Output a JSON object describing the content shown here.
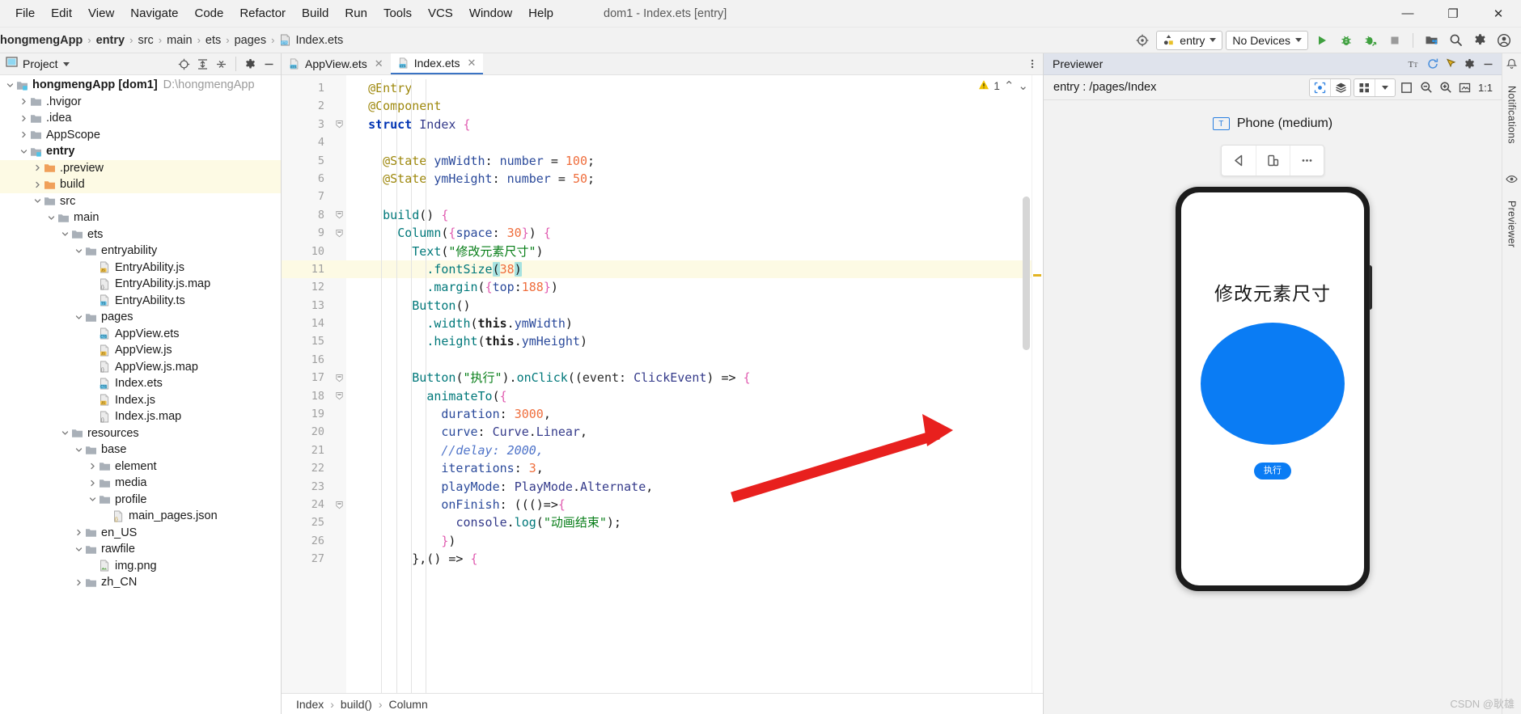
{
  "window": {
    "title": "dom1 - Index.ets [entry]",
    "menu": [
      "File",
      "Edit",
      "View",
      "Navigate",
      "Code",
      "Refactor",
      "Build",
      "Run",
      "Tools",
      "VCS",
      "Window",
      "Help"
    ],
    "controls": {
      "minimize": "—",
      "maximize": "❐",
      "close": "✕"
    }
  },
  "navbar": {
    "breadcrumbs": [
      "hongmengApp",
      "entry",
      "src",
      "main",
      "ets",
      "pages",
      "Index.ets"
    ],
    "run_config": "entry",
    "device_selector": "No Devices",
    "icons": [
      "target-icon",
      "run-icon",
      "debug-icon",
      "profile-icon",
      "stop-icon",
      "device-manager-icon",
      "search-icon",
      "settings-gear-icon",
      "account-icon"
    ]
  },
  "project_panel": {
    "title": "Project",
    "tools": [
      "locate-icon",
      "expand-all-icon",
      "collapse-all-icon",
      "settings-gear-icon",
      "hide-icon"
    ],
    "tree": [
      {
        "label": "hongmengApp [dom1]",
        "suffix": "D:\\hongmengApp",
        "depth": 0,
        "arrow": "down",
        "icon": "module-folder",
        "bold": true
      },
      {
        "label": ".hvigor",
        "depth": 1,
        "arrow": "right",
        "icon": "folder"
      },
      {
        "label": ".idea",
        "depth": 1,
        "arrow": "right",
        "icon": "folder"
      },
      {
        "label": "AppScope",
        "depth": 1,
        "arrow": "right",
        "icon": "folder"
      },
      {
        "label": "entry",
        "depth": 1,
        "arrow": "down",
        "icon": "module-folder",
        "bold": true
      },
      {
        "label": ".preview",
        "depth": 2,
        "arrow": "right",
        "icon": "folder-orange",
        "highlight": true
      },
      {
        "label": "build",
        "depth": 2,
        "arrow": "right",
        "icon": "folder-orange",
        "highlight": true
      },
      {
        "label": "src",
        "depth": 2,
        "arrow": "down",
        "icon": "folder"
      },
      {
        "label": "main",
        "depth": 3,
        "arrow": "down",
        "icon": "folder"
      },
      {
        "label": "ets",
        "depth": 4,
        "arrow": "down",
        "icon": "folder"
      },
      {
        "label": "entryability",
        "depth": 5,
        "arrow": "down",
        "icon": "folder"
      },
      {
        "label": "EntryAbility.js",
        "depth": 6,
        "arrow": "none",
        "icon": "js-file"
      },
      {
        "label": "EntryAbility.js.map",
        "depth": 6,
        "arrow": "none",
        "icon": "map-file"
      },
      {
        "label": "EntryAbility.ts",
        "depth": 6,
        "arrow": "none",
        "icon": "ts-file"
      },
      {
        "label": "pages",
        "depth": 5,
        "arrow": "down",
        "icon": "folder"
      },
      {
        "label": "AppView.ets",
        "depth": 6,
        "arrow": "none",
        "icon": "ets-file"
      },
      {
        "label": "AppView.js",
        "depth": 6,
        "arrow": "none",
        "icon": "js-file"
      },
      {
        "label": "AppView.js.map",
        "depth": 6,
        "arrow": "none",
        "icon": "map-file"
      },
      {
        "label": "Index.ets",
        "depth": 6,
        "arrow": "none",
        "icon": "ets-file"
      },
      {
        "label": "Index.js",
        "depth": 6,
        "arrow": "none",
        "icon": "js-file"
      },
      {
        "label": "Index.js.map",
        "depth": 6,
        "arrow": "none",
        "icon": "map-file"
      },
      {
        "label": "resources",
        "depth": 4,
        "arrow": "down",
        "icon": "folder"
      },
      {
        "label": "base",
        "depth": 5,
        "arrow": "down",
        "icon": "folder"
      },
      {
        "label": "element",
        "depth": 6,
        "arrow": "right",
        "icon": "folder"
      },
      {
        "label": "media",
        "depth": 6,
        "arrow": "right",
        "icon": "folder"
      },
      {
        "label": "profile",
        "depth": 6,
        "arrow": "down",
        "icon": "folder"
      },
      {
        "label": "main_pages.json",
        "depth": 7,
        "arrow": "none",
        "icon": "json-file"
      },
      {
        "label": "en_US",
        "depth": 5,
        "arrow": "right",
        "icon": "folder"
      },
      {
        "label": "rawfile",
        "depth": 5,
        "arrow": "down",
        "icon": "folder"
      },
      {
        "label": "img.png",
        "depth": 6,
        "arrow": "none",
        "icon": "png-file"
      },
      {
        "label": "zh_CN",
        "depth": 5,
        "arrow": "right",
        "icon": "folder"
      }
    ]
  },
  "editor": {
    "tabs": [
      {
        "label": "AppView.ets",
        "icon": "ets-file",
        "active": false,
        "close": "✕"
      },
      {
        "label": "Index.ets",
        "icon": "ets-file",
        "active": true,
        "close": "✕"
      }
    ],
    "inspection": {
      "warning_count": "1",
      "up": "⌃",
      "down": "⌄"
    },
    "highlighted_line": 11,
    "breadcrumb": [
      "Index",
      "build()",
      "Column"
    ],
    "lines": [
      {
        "n": 1,
        "fold": "",
        "tokens": [
          {
            "t": "  ",
            "c": "t-pl"
          },
          {
            "t": "@Entry",
            "c": "t-ann"
          }
        ]
      },
      {
        "n": 2,
        "fold": "",
        "tokens": [
          {
            "t": "  ",
            "c": "t-pl"
          },
          {
            "t": "@Component",
            "c": "t-ann"
          }
        ]
      },
      {
        "n": 3,
        "fold": "minus",
        "tokens": [
          {
            "t": "  ",
            "c": "t-pl"
          },
          {
            "t": "struct",
            "c": "t-kw"
          },
          {
            "t": " ",
            "c": "t-pl"
          },
          {
            "t": "Index",
            "c": "t-cls"
          },
          {
            "t": " ",
            "c": "t-pl"
          },
          {
            "t": "{",
            "c": "t-brace"
          }
        ]
      },
      {
        "n": 4,
        "fold": "",
        "tokens": []
      },
      {
        "n": 5,
        "fold": "",
        "tokens": [
          {
            "t": "    ",
            "c": "t-pl"
          },
          {
            "t": "@State",
            "c": "t-ann"
          },
          {
            "t": " ",
            "c": "t-pl"
          },
          {
            "t": "ymWidth",
            "c": "t-prop"
          },
          {
            "t": ": ",
            "c": "t-pl"
          },
          {
            "t": "number",
            "c": "t-prop"
          },
          {
            "t": " = ",
            "c": "t-pl"
          },
          {
            "t": "100",
            "c": "t-num"
          },
          {
            "t": ";",
            "c": "t-pl"
          }
        ]
      },
      {
        "n": 6,
        "fold": "",
        "tokens": [
          {
            "t": "    ",
            "c": "t-pl"
          },
          {
            "t": "@State",
            "c": "t-ann"
          },
          {
            "t": " ",
            "c": "t-pl"
          },
          {
            "t": "ymHeight",
            "c": "t-prop"
          },
          {
            "t": ": ",
            "c": "t-pl"
          },
          {
            "t": "number",
            "c": "t-prop"
          },
          {
            "t": " = ",
            "c": "t-pl"
          },
          {
            "t": "50",
            "c": "t-num"
          },
          {
            "t": ";",
            "c": "t-pl"
          }
        ]
      },
      {
        "n": 7,
        "fold": "",
        "tokens": []
      },
      {
        "n": 8,
        "fold": "minus",
        "tokens": [
          {
            "t": "    ",
            "c": "t-pl"
          },
          {
            "t": "build",
            "c": "t-fn"
          },
          {
            "t": "() ",
            "c": "t-pl"
          },
          {
            "t": "{",
            "c": "t-brace"
          }
        ]
      },
      {
        "n": 9,
        "fold": "minus",
        "tokens": [
          {
            "t": "      ",
            "c": "t-pl"
          },
          {
            "t": "Column",
            "c": "t-fn"
          },
          {
            "t": "(",
            "c": "t-pl"
          },
          {
            "t": "{",
            "c": "t-brace"
          },
          {
            "t": "space",
            "c": "t-prop"
          },
          {
            "t": ": ",
            "c": "t-pl"
          },
          {
            "t": "30",
            "c": "t-num"
          },
          {
            "t": "}",
            "c": "t-brace"
          },
          {
            "t": ") ",
            "c": "t-pl"
          },
          {
            "t": "{",
            "c": "t-brace"
          }
        ]
      },
      {
        "n": 10,
        "fold": "",
        "tokens": [
          {
            "t": "        ",
            "c": "t-pl"
          },
          {
            "t": "Text",
            "c": "t-fn"
          },
          {
            "t": "(",
            "c": "t-pl"
          },
          {
            "t": "\"修改元素尺寸\"",
            "c": "t-str"
          },
          {
            "t": ")",
            "c": "t-pl"
          }
        ]
      },
      {
        "n": 11,
        "fold": "",
        "tokens": [
          {
            "t": "          ",
            "c": "t-pl"
          },
          {
            "t": ".fontSize",
            "c": "t-fn"
          },
          {
            "t": "(",
            "c": "t-pl",
            "sel": true
          },
          {
            "t": "38",
            "c": "t-num"
          },
          {
            "t": ")",
            "c": "t-pl",
            "sel": true
          }
        ]
      },
      {
        "n": 12,
        "fold": "",
        "tokens": [
          {
            "t": "          ",
            "c": "t-pl"
          },
          {
            "t": ".margin",
            "c": "t-fn"
          },
          {
            "t": "(",
            "c": "t-pl"
          },
          {
            "t": "{",
            "c": "t-brace"
          },
          {
            "t": "top",
            "c": "t-prop"
          },
          {
            "t": ":",
            "c": "t-pl"
          },
          {
            "t": "188",
            "c": "t-num"
          },
          {
            "t": "}",
            "c": "t-brace"
          },
          {
            "t": ")",
            "c": "t-pl"
          }
        ]
      },
      {
        "n": 13,
        "fold": "",
        "tokens": [
          {
            "t": "        ",
            "c": "t-pl"
          },
          {
            "t": "Button",
            "c": "t-fn"
          },
          {
            "t": "()",
            "c": "t-pl"
          }
        ]
      },
      {
        "n": 14,
        "fold": "",
        "tokens": [
          {
            "t": "          ",
            "c": "t-pl"
          },
          {
            "t": ".width",
            "c": "t-fn"
          },
          {
            "t": "(",
            "c": "t-pl"
          },
          {
            "t": "this",
            "c": "t-this"
          },
          {
            "t": ".",
            "c": "t-pl"
          },
          {
            "t": "ymWidth",
            "c": "t-prop"
          },
          {
            "t": ")",
            "c": "t-pl"
          }
        ]
      },
      {
        "n": 15,
        "fold": "",
        "tokens": [
          {
            "t": "          ",
            "c": "t-pl"
          },
          {
            "t": ".height",
            "c": "t-fn"
          },
          {
            "t": "(",
            "c": "t-pl"
          },
          {
            "t": "this",
            "c": "t-this"
          },
          {
            "t": ".",
            "c": "t-pl"
          },
          {
            "t": "ymHeight",
            "c": "t-prop"
          },
          {
            "t": ")",
            "c": "t-pl"
          }
        ]
      },
      {
        "n": 16,
        "fold": "",
        "tokens": []
      },
      {
        "n": 17,
        "fold": "minus",
        "tokens": [
          {
            "t": "        ",
            "c": "t-pl"
          },
          {
            "t": "Button",
            "c": "t-fn"
          },
          {
            "t": "(",
            "c": "t-pl"
          },
          {
            "t": "\"执行\"",
            "c": "t-str"
          },
          {
            "t": ").",
            "c": "t-pl"
          },
          {
            "t": "onClick",
            "c": "t-fn"
          },
          {
            "t": "((",
            "c": "t-pl"
          },
          {
            "t": "event",
            "c": "t-param"
          },
          {
            "t": ": ",
            "c": "t-pl"
          },
          {
            "t": "ClickEvent",
            "c": "t-cls"
          },
          {
            "t": ") => ",
            "c": "t-pl"
          },
          {
            "t": "{",
            "c": "t-brace"
          }
        ]
      },
      {
        "n": 18,
        "fold": "minus",
        "tokens": [
          {
            "t": "          ",
            "c": "t-pl"
          },
          {
            "t": "animateTo",
            "c": "t-fn"
          },
          {
            "t": "(",
            "c": "t-pl"
          },
          {
            "t": "{",
            "c": "t-brace"
          }
        ]
      },
      {
        "n": 19,
        "fold": "",
        "tokens": [
          {
            "t": "            ",
            "c": "t-pl"
          },
          {
            "t": "duration",
            "c": "t-prop"
          },
          {
            "t": ": ",
            "c": "t-pl"
          },
          {
            "t": "3000",
            "c": "t-num"
          },
          {
            "t": ",",
            "c": "t-pl"
          }
        ]
      },
      {
        "n": 20,
        "fold": "",
        "tokens": [
          {
            "t": "            ",
            "c": "t-pl"
          },
          {
            "t": "curve",
            "c": "t-prop"
          },
          {
            "t": ": ",
            "c": "t-pl"
          },
          {
            "t": "Curve",
            "c": "t-cls"
          },
          {
            "t": ".",
            "c": "t-pl"
          },
          {
            "t": "Linear",
            "c": "t-cls"
          },
          {
            "t": ",",
            "c": "t-pl"
          }
        ]
      },
      {
        "n": 21,
        "fold": "",
        "tokens": [
          {
            "t": "            ",
            "c": "t-pl"
          },
          {
            "t": "//delay: 2000,",
            "c": "t-com"
          }
        ]
      },
      {
        "n": 22,
        "fold": "",
        "tokens": [
          {
            "t": "            ",
            "c": "t-pl"
          },
          {
            "t": "iterations",
            "c": "t-prop"
          },
          {
            "t": ": ",
            "c": "t-pl"
          },
          {
            "t": "3",
            "c": "t-num"
          },
          {
            "t": ",",
            "c": "t-pl"
          }
        ]
      },
      {
        "n": 23,
        "fold": "",
        "tokens": [
          {
            "t": "            ",
            "c": "t-pl"
          },
          {
            "t": "playMode",
            "c": "t-prop"
          },
          {
            "t": ": ",
            "c": "t-pl"
          },
          {
            "t": "PlayMode",
            "c": "t-cls"
          },
          {
            "t": ".",
            "c": "t-pl"
          },
          {
            "t": "Alternate",
            "c": "t-cls"
          },
          {
            "t": ",",
            "c": "t-pl"
          }
        ]
      },
      {
        "n": 24,
        "fold": "minus",
        "tokens": [
          {
            "t": "            ",
            "c": "t-pl"
          },
          {
            "t": "onFinish",
            "c": "t-prop"
          },
          {
            "t": ": ((()=>",
            "c": "t-pl"
          },
          {
            "t": "{",
            "c": "t-brace"
          }
        ]
      },
      {
        "n": 25,
        "fold": "",
        "tokens": [
          {
            "t": "              ",
            "c": "t-pl"
          },
          {
            "t": "console",
            "c": "t-cls"
          },
          {
            "t": ".",
            "c": "t-pl"
          },
          {
            "t": "log",
            "c": "t-fn"
          },
          {
            "t": "(",
            "c": "t-pl"
          },
          {
            "t": "\"动画结束\"",
            "c": "t-str"
          },
          {
            "t": ");",
            "c": "t-pl"
          }
        ]
      },
      {
        "n": 26,
        "fold": "",
        "tokens": [
          {
            "t": "            ",
            "c": "t-pl"
          },
          {
            "t": "}",
            "c": "t-brace"
          },
          {
            "t": ")",
            "c": "t-pl"
          }
        ]
      },
      {
        "n": 27,
        "fold": "",
        "tokens": [
          {
            "t": "        ",
            "c": "t-pl"
          },
          {
            "t": "},() => ",
            "c": "t-pl"
          },
          {
            "t": "{",
            "c": "t-brace"
          }
        ]
      }
    ]
  },
  "previewer": {
    "title": "Previewer",
    "route": "entry : /pages/Index",
    "header_icons": [
      "font-size-icon",
      "refresh-icon",
      "inspector-icon",
      "settings-gear-icon",
      "hide-icon"
    ],
    "sub_icons": [
      "select-target-icon",
      "layers-icon",
      "grid-icon",
      "chevron-down-icon",
      "fit-icon",
      "zoom-out-icon",
      "zoom-in-icon",
      "screenshot-icon",
      "actual-size-icon"
    ],
    "actual_size_label": "1:1",
    "device_name": "Phone (medium)",
    "device_chip_text": "T",
    "device_toolbar": [
      "rotate-left-icon",
      "multi-device-icon",
      "more-icon"
    ],
    "screen": {
      "title": "修改元素尺寸",
      "button_label": "执行",
      "circle_color": "#0a7cf4"
    }
  },
  "right_rail": {
    "items": [
      "Notifications",
      "Previewer"
    ],
    "icons": [
      "bell-icon",
      "eye-icon"
    ]
  },
  "watermark": "CSDN @耿雄"
}
